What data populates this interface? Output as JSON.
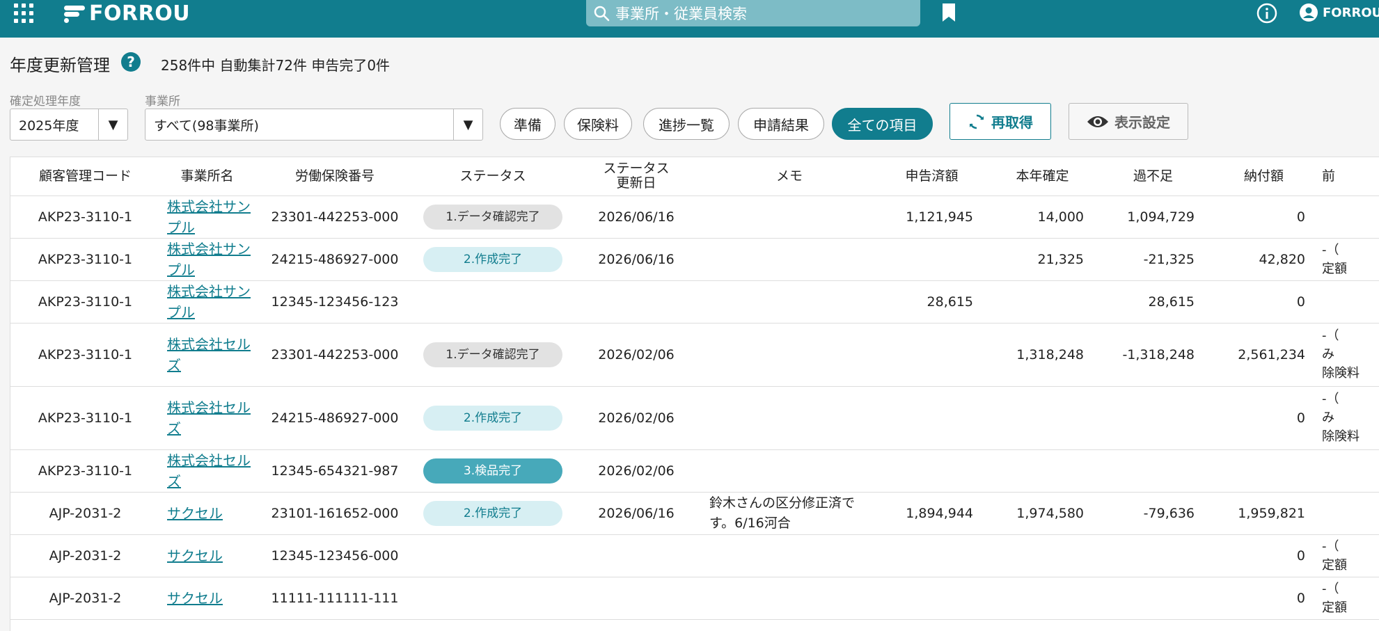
{
  "header": {
    "brand": "FORROU",
    "search_placeholder": "事業所・従業員検索",
    "user_name": "FORROU"
  },
  "page": {
    "title": "年度更新管理",
    "help": "?",
    "summary": "258件中 自動集計72件 申告完了0件"
  },
  "filters": {
    "year_label": "確定処理年度",
    "year_value": "2025年度",
    "office_label": "事業所",
    "office_value": "すべて(98事業所)",
    "arrow": "▼"
  },
  "tabs": [
    {
      "label": "準備"
    },
    {
      "label": "保険料"
    },
    {
      "label": "進捗一覧"
    },
    {
      "label": "申請結果"
    },
    {
      "label": "全ての項目"
    }
  ],
  "buttons": {
    "refetch": "再取得",
    "display_settings": "表示設定"
  },
  "table": {
    "headers": [
      "顧客管理コード",
      "事業所名",
      "労働保険番号",
      "ステータス",
      "ステータス\n更新日",
      "メモ",
      "申告済額",
      "本年確定",
      "過不足",
      "納付額",
      "前"
    ],
    "rows": [
      {
        "code": "AKP23-3110-1",
        "name": "株式会社サンプル",
        "number": "23301-442253-000",
        "status": "1.データ確認完了",
        "status_type": "s1",
        "date": "2026/06/16",
        "memo": "",
        "declared": "1,121,945",
        "confirmed": "14,000",
        "diff": "1,094,729",
        "payment": "0",
        "prev": ""
      },
      {
        "code": "AKP23-3110-1",
        "name": "株式会社サンプル",
        "number": "24215-486927-000",
        "status": "2.作成完了",
        "status_type": "s2",
        "date": "2026/06/16",
        "memo": "",
        "declared": "",
        "confirmed": "21,325",
        "diff": "-21,325",
        "payment": "42,820",
        "prev": "-（\n定額"
      },
      {
        "code": "AKP23-3110-1",
        "name": "株式会社サンプル",
        "number": "12345-123456-123",
        "status": "",
        "status_type": "",
        "date": "",
        "memo": "",
        "declared": "28,615",
        "confirmed": "",
        "diff": "28,615",
        "payment": "0",
        "prev": ""
      },
      {
        "code": "AKP23-3110-1",
        "name": "株式会社セルズ",
        "number": "23301-442253-000",
        "status": "1.データ確認完了",
        "status_type": "s1",
        "date": "2026/02/06",
        "memo": "",
        "declared": "",
        "confirmed": "1,318,248",
        "diff": "-1,318,248",
        "payment": "2,561,234",
        "prev": "-（\n み\n除険料"
      },
      {
        "code": "AKP23-3110-1",
        "name": "株式会社セルズ",
        "number": "24215-486927-000",
        "status": "2.作成完了",
        "status_type": "s2",
        "date": "2026/02/06",
        "memo": "",
        "declared": "",
        "confirmed": "",
        "diff": "",
        "payment": "0",
        "prev": "-（\n み\n除険料"
      },
      {
        "code": "AKP23-3110-1",
        "name": "株式会社セルズ",
        "number": "12345-654321-987",
        "status": "3.検品完了",
        "status_type": "s3",
        "date": "2026/02/06",
        "memo": "",
        "declared": "",
        "confirmed": "",
        "diff": "",
        "payment": "",
        "prev": ""
      },
      {
        "code": "AJP-2031-2",
        "name": "サクセル",
        "number": "23101-161652-000",
        "status": "2.作成完了",
        "status_type": "s2",
        "date": "2026/06/16",
        "memo": "鈴木さんの区分修正済で\nす。6/16河合",
        "declared": "1,894,944",
        "confirmed": "1,974,580",
        "diff": "-79,636",
        "payment": "1,959,821",
        "prev": ""
      },
      {
        "code": "AJP-2031-2",
        "name": "サクセル",
        "number": "12345-123456-000",
        "status": "",
        "status_type": "",
        "date": "",
        "memo": "",
        "declared": "",
        "confirmed": "",
        "diff": "",
        "payment": "0",
        "prev": "-（\n定額"
      },
      {
        "code": "AJP-2031-2",
        "name": "サクセル",
        "number": "11111-111111-111",
        "status": "",
        "status_type": "",
        "date": "",
        "memo": "",
        "declared": "",
        "confirmed": "",
        "diff": "",
        "payment": "0",
        "prev": "-（\n定額"
      },
      {
        "code": "",
        "name": "",
        "number": "",
        "status": "",
        "status_type": "",
        "date": "",
        "memo": "",
        "declared": "",
        "confirmed": "",
        "diff": "",
        "payment": "",
        "prev": "-（"
      }
    ]
  },
  "colors": {
    "brand": "#117d8e",
    "search_bg": "#7dbcc6",
    "badge_grey": "#e2e2e2",
    "badge_light": "#d7eff3",
    "badge_dark": "#47a9ba"
  }
}
